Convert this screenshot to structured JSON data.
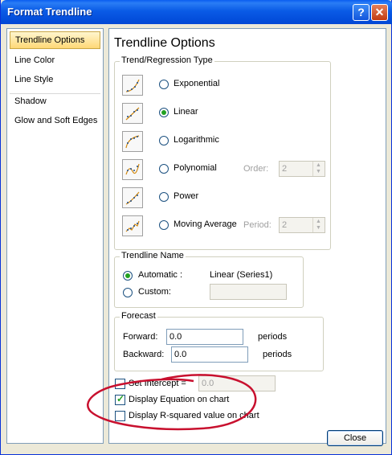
{
  "window": {
    "title": "Format Trendline",
    "help_glyph": "?",
    "close_glyph": "✕"
  },
  "nav": {
    "items": [
      {
        "label": "Trendline Options",
        "selected": true
      },
      {
        "label": "Line Color"
      },
      {
        "label": "Line Style"
      },
      {
        "label": "Shadow"
      },
      {
        "label": "Glow and Soft Edges"
      }
    ]
  },
  "panel": {
    "title": "Trendline Options",
    "type_group": {
      "label": "Trend/Regression Type",
      "options": [
        {
          "label": "Exponential",
          "selected": false
        },
        {
          "label": "Linear",
          "selected": true
        },
        {
          "label": "Logarithmic",
          "selected": false
        },
        {
          "label": "Polynomial",
          "selected": false,
          "param_label": "Order:",
          "param_value": "2"
        },
        {
          "label": "Power",
          "selected": false
        },
        {
          "label": "Moving Average",
          "selected": false,
          "param_label": "Period:",
          "param_value": "2"
        }
      ]
    },
    "name_group": {
      "label": "Trendline Name",
      "automatic_label": "Automatic :",
      "automatic_value": "Linear (Series1)",
      "automatic_selected": true,
      "custom_label": "Custom:",
      "custom_value": ""
    },
    "forecast_group": {
      "label": "Forecast",
      "forward_label": "Forward:",
      "forward_value": "0.0",
      "forward_unit": "periods",
      "backward_label": "Backward:",
      "backward_value": "0.0",
      "backward_unit": "periods"
    },
    "checks": {
      "set_intercept_label": "Set Intercept =",
      "set_intercept_checked": false,
      "set_intercept_value": "0.0",
      "display_equation_label": "Display Equation on chart",
      "display_equation_checked": true,
      "display_r2_label": "Display R-squared value on chart",
      "display_r2_checked": false
    }
  },
  "footer": {
    "close_label": "Close"
  },
  "colors": {
    "title_bar": "#0a5be6",
    "selection": "#ffd876",
    "annotation": "#c8102e",
    "accent": "#21a121"
  },
  "icons": [
    "help-icon",
    "close-icon",
    "exponential-trend-icon",
    "linear-trend-icon",
    "logarithmic-trend-icon",
    "polynomial-trend-icon",
    "power-trend-icon",
    "moving-average-trend-icon"
  ]
}
